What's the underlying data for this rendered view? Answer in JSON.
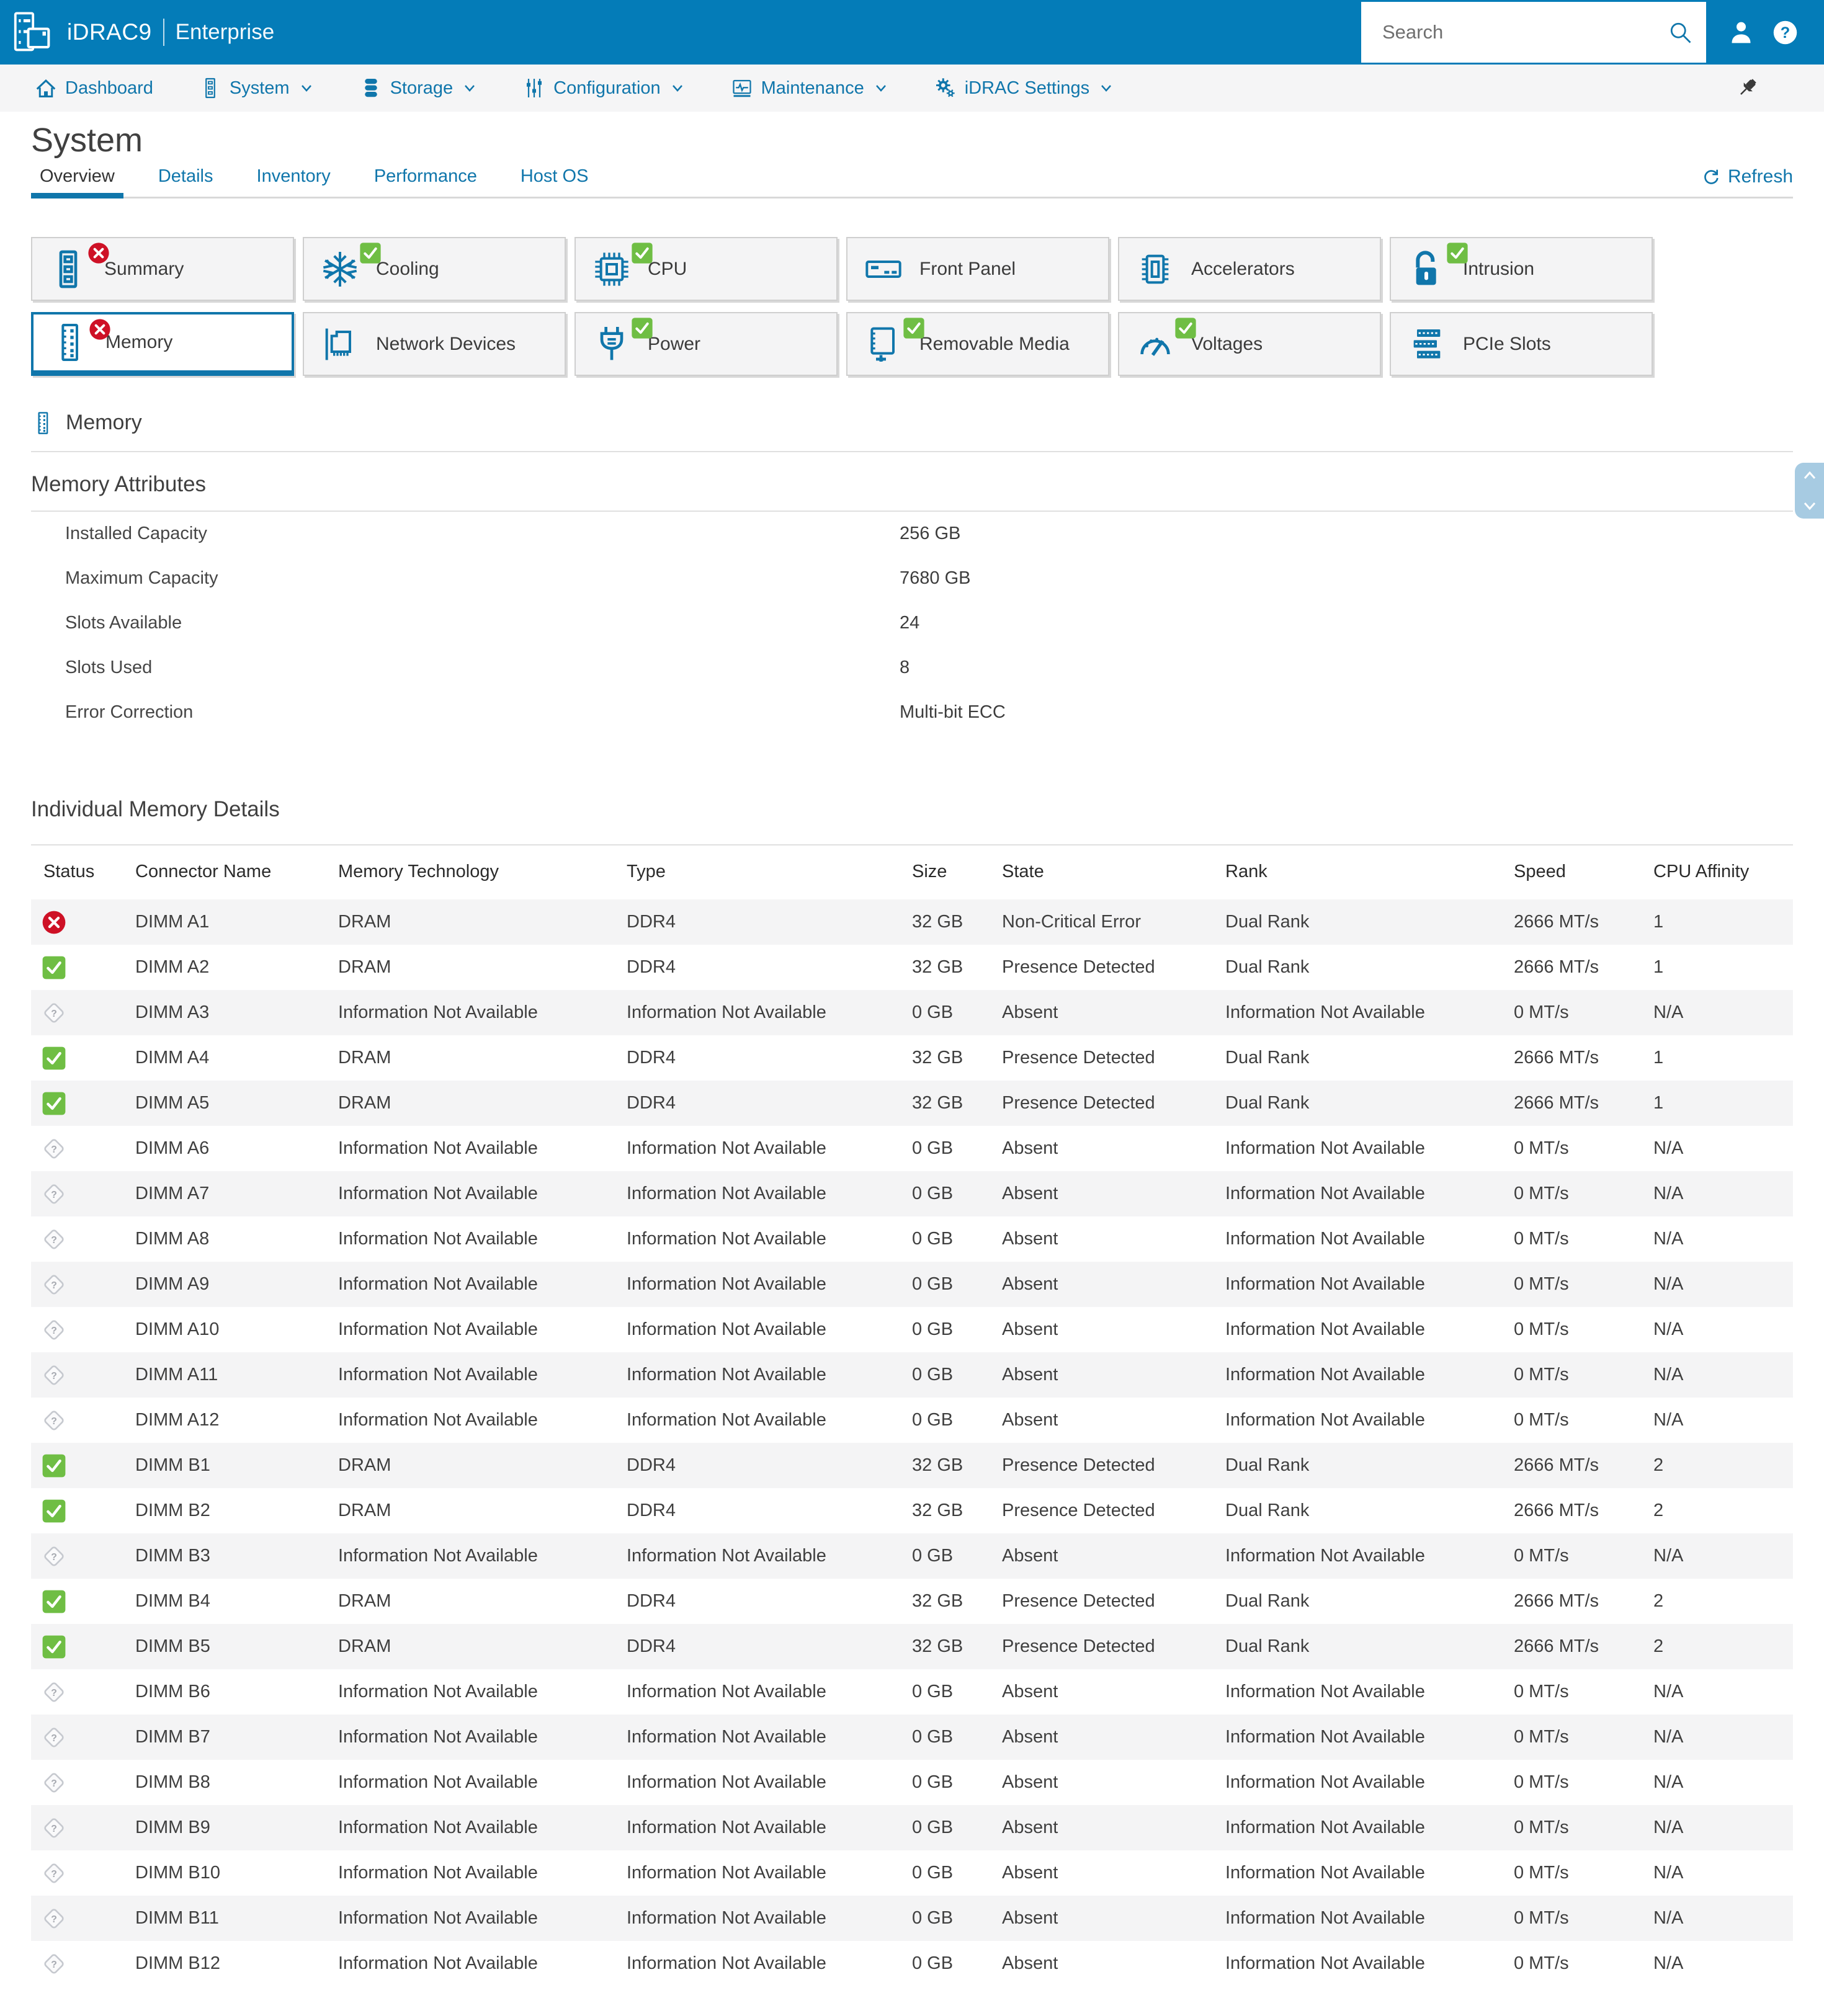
{
  "colors": {
    "header_blue": "#047CB8",
    "link_blue": "#1076AB",
    "ok_green": "#6FBE44",
    "error_red": "#CE1126"
  },
  "header": {
    "brand": "iDRAC9",
    "edition": "Enterprise",
    "search_placeholder": "Search"
  },
  "nav": {
    "items": [
      {
        "label": "Dashboard",
        "icon": "home-icon",
        "dropdown": false
      },
      {
        "label": "System",
        "icon": "system-menu-icon",
        "dropdown": true
      },
      {
        "label": "Storage",
        "icon": "storage-menu-icon",
        "dropdown": true
      },
      {
        "label": "Configuration",
        "icon": "configuration-menu-icon",
        "dropdown": true
      },
      {
        "label": "Maintenance",
        "icon": "maintenance-menu-icon",
        "dropdown": true
      },
      {
        "label": "iDRAC Settings",
        "icon": "idrac-settings-menu-icon",
        "dropdown": true
      }
    ]
  },
  "page": {
    "title": "System",
    "tabs": [
      {
        "label": "Overview",
        "active": true
      },
      {
        "label": "Details",
        "active": false
      },
      {
        "label": "Inventory",
        "active": false
      },
      {
        "label": "Performance",
        "active": false
      },
      {
        "label": "Host OS",
        "active": false
      }
    ],
    "refresh_label": "Refresh"
  },
  "tiles": [
    {
      "label": "Summary",
      "icon": "summary-icon",
      "status": "error",
      "selected": false
    },
    {
      "label": "Cooling",
      "icon": "cooling-icon",
      "status": "ok",
      "selected": false
    },
    {
      "label": "CPU",
      "icon": "cpu-icon",
      "status": "ok",
      "selected": false
    },
    {
      "label": "Front Panel",
      "icon": "front-panel-icon",
      "status": null,
      "selected": false
    },
    {
      "label": "Accelerators",
      "icon": "accelerators-icon",
      "status": null,
      "selected": false
    },
    {
      "label": "Intrusion",
      "icon": "intrusion-icon",
      "status": "ok",
      "selected": false
    },
    {
      "label": "Memory",
      "icon": "memory-icon",
      "status": "error",
      "selected": true
    },
    {
      "label": "Network Devices",
      "icon": "network-devices-icon",
      "status": null,
      "selected": false
    },
    {
      "label": "Power",
      "icon": "power-icon",
      "status": "ok",
      "selected": false
    },
    {
      "label": "Removable Media",
      "icon": "removable-media-icon",
      "status": "ok",
      "selected": false
    },
    {
      "label": "Voltages",
      "icon": "voltages-icon",
      "status": "ok",
      "selected": false
    },
    {
      "label": "PCIe Slots",
      "icon": "pcie-slots-icon",
      "status": null,
      "selected": false
    }
  ],
  "memory_section": {
    "title": "Memory",
    "icon": "memory-section-icon"
  },
  "memory_attributes": {
    "title": "Memory Attributes",
    "rows": [
      {
        "label": "Installed Capacity",
        "value": "256 GB"
      },
      {
        "label": "Maximum Capacity",
        "value": "7680 GB"
      },
      {
        "label": "Slots Available",
        "value": "24"
      },
      {
        "label": "Slots Used",
        "value": "8"
      },
      {
        "label": "Error Correction",
        "value": "Multi-bit ECC"
      }
    ]
  },
  "memory_details": {
    "title": "Individual Memory Details",
    "columns": [
      "Status",
      "Connector Name",
      "Memory Technology",
      "Type",
      "Size",
      "State",
      "Rank",
      "Speed",
      "CPU Affinity"
    ],
    "rows": [
      {
        "status": "error",
        "connector": "DIMM A1",
        "technology": "DRAM",
        "type": "DDR4",
        "size": "32 GB",
        "state": "Non-Critical Error",
        "rank": "Dual Rank",
        "speed": "2666 MT/s",
        "cpu_affinity": "1"
      },
      {
        "status": "ok",
        "connector": "DIMM A2",
        "technology": "DRAM",
        "type": "DDR4",
        "size": "32 GB",
        "state": "Presence Detected",
        "rank": "Dual Rank",
        "speed": "2666 MT/s",
        "cpu_affinity": "1"
      },
      {
        "status": "unknown",
        "connector": "DIMM A3",
        "technology": "Information Not Available",
        "type": "Information Not Available",
        "size": "0 GB",
        "state": "Absent",
        "rank": "Information Not Available",
        "speed": "0 MT/s",
        "cpu_affinity": "N/A"
      },
      {
        "status": "ok",
        "connector": "DIMM A4",
        "technology": "DRAM",
        "type": "DDR4",
        "size": "32 GB",
        "state": "Presence Detected",
        "rank": "Dual Rank",
        "speed": "2666 MT/s",
        "cpu_affinity": "1"
      },
      {
        "status": "ok",
        "connector": "DIMM A5",
        "technology": "DRAM",
        "type": "DDR4",
        "size": "32 GB",
        "state": "Presence Detected",
        "rank": "Dual Rank",
        "speed": "2666 MT/s",
        "cpu_affinity": "1"
      },
      {
        "status": "unknown",
        "connector": "DIMM A6",
        "technology": "Information Not Available",
        "type": "Information Not Available",
        "size": "0 GB",
        "state": "Absent",
        "rank": "Information Not Available",
        "speed": "0 MT/s",
        "cpu_affinity": "N/A"
      },
      {
        "status": "unknown",
        "connector": "DIMM A7",
        "technology": "Information Not Available",
        "type": "Information Not Available",
        "size": "0 GB",
        "state": "Absent",
        "rank": "Information Not Available",
        "speed": "0 MT/s",
        "cpu_affinity": "N/A"
      },
      {
        "status": "unknown",
        "connector": "DIMM A8",
        "technology": "Information Not Available",
        "type": "Information Not Available",
        "size": "0 GB",
        "state": "Absent",
        "rank": "Information Not Available",
        "speed": "0 MT/s",
        "cpu_affinity": "N/A"
      },
      {
        "status": "unknown",
        "connector": "DIMM A9",
        "technology": "Information Not Available",
        "type": "Information Not Available",
        "size": "0 GB",
        "state": "Absent",
        "rank": "Information Not Available",
        "speed": "0 MT/s",
        "cpu_affinity": "N/A"
      },
      {
        "status": "unknown",
        "connector": "DIMM A10",
        "technology": "Information Not Available",
        "type": "Information Not Available",
        "size": "0 GB",
        "state": "Absent",
        "rank": "Information Not Available",
        "speed": "0 MT/s",
        "cpu_affinity": "N/A"
      },
      {
        "status": "unknown",
        "connector": "DIMM A11",
        "technology": "Information Not Available",
        "type": "Information Not Available",
        "size": "0 GB",
        "state": "Absent",
        "rank": "Information Not Available",
        "speed": "0 MT/s",
        "cpu_affinity": "N/A"
      },
      {
        "status": "unknown",
        "connector": "DIMM A12",
        "technology": "Information Not Available",
        "type": "Information Not Available",
        "size": "0 GB",
        "state": "Absent",
        "rank": "Information Not Available",
        "speed": "0 MT/s",
        "cpu_affinity": "N/A"
      },
      {
        "status": "ok",
        "connector": "DIMM B1",
        "technology": "DRAM",
        "type": "DDR4",
        "size": "32 GB",
        "state": "Presence Detected",
        "rank": "Dual Rank",
        "speed": "2666 MT/s",
        "cpu_affinity": "2"
      },
      {
        "status": "ok",
        "connector": "DIMM B2",
        "technology": "DRAM",
        "type": "DDR4",
        "size": "32 GB",
        "state": "Presence Detected",
        "rank": "Dual Rank",
        "speed": "2666 MT/s",
        "cpu_affinity": "2"
      },
      {
        "status": "unknown",
        "connector": "DIMM B3",
        "technology": "Information Not Available",
        "type": "Information Not Available",
        "size": "0 GB",
        "state": "Absent",
        "rank": "Information Not Available",
        "speed": "0 MT/s",
        "cpu_affinity": "N/A"
      },
      {
        "status": "ok",
        "connector": "DIMM B4",
        "technology": "DRAM",
        "type": "DDR4",
        "size": "32 GB",
        "state": "Presence Detected",
        "rank": "Dual Rank",
        "speed": "2666 MT/s",
        "cpu_affinity": "2"
      },
      {
        "status": "ok",
        "connector": "DIMM B5",
        "technology": "DRAM",
        "type": "DDR4",
        "size": "32 GB",
        "state": "Presence Detected",
        "rank": "Dual Rank",
        "speed": "2666 MT/s",
        "cpu_affinity": "2"
      },
      {
        "status": "unknown",
        "connector": "DIMM B6",
        "technology": "Information Not Available",
        "type": "Information Not Available",
        "size": "0 GB",
        "state": "Absent",
        "rank": "Information Not Available",
        "speed": "0 MT/s",
        "cpu_affinity": "N/A"
      },
      {
        "status": "unknown",
        "connector": "DIMM B7",
        "technology": "Information Not Available",
        "type": "Information Not Available",
        "size": "0 GB",
        "state": "Absent",
        "rank": "Information Not Available",
        "speed": "0 MT/s",
        "cpu_affinity": "N/A"
      },
      {
        "status": "unknown",
        "connector": "DIMM B8",
        "technology": "Information Not Available",
        "type": "Information Not Available",
        "size": "0 GB",
        "state": "Absent",
        "rank": "Information Not Available",
        "speed": "0 MT/s",
        "cpu_affinity": "N/A"
      },
      {
        "status": "unknown",
        "connector": "DIMM B9",
        "technology": "Information Not Available",
        "type": "Information Not Available",
        "size": "0 GB",
        "state": "Absent",
        "rank": "Information Not Available",
        "speed": "0 MT/s",
        "cpu_affinity": "N/A"
      },
      {
        "status": "unknown",
        "connector": "DIMM B10",
        "technology": "Information Not Available",
        "type": "Information Not Available",
        "size": "0 GB",
        "state": "Absent",
        "rank": "Information Not Available",
        "speed": "0 MT/s",
        "cpu_affinity": "N/A"
      },
      {
        "status": "unknown",
        "connector": "DIMM B11",
        "technology": "Information Not Available",
        "type": "Information Not Available",
        "size": "0 GB",
        "state": "Absent",
        "rank": "Information Not Available",
        "speed": "0 MT/s",
        "cpu_affinity": "N/A"
      },
      {
        "status": "unknown",
        "connector": "DIMM B12",
        "technology": "Information Not Available",
        "type": "Information Not Available",
        "size": "0 GB",
        "state": "Absent",
        "rank": "Information Not Available",
        "speed": "0 MT/s",
        "cpu_affinity": "N/A"
      }
    ]
  }
}
